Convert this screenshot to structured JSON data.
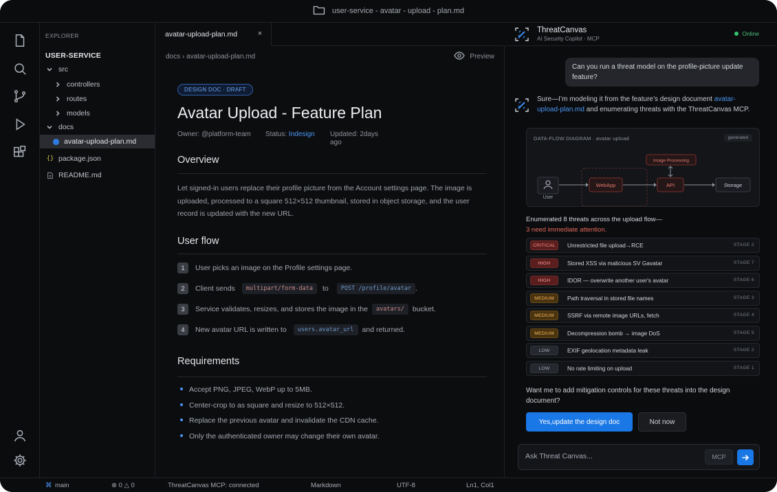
{
  "window": {
    "title": "user-service - avatar - upload - plan.md"
  },
  "activity_bar": {
    "icons": [
      "files-icon",
      "search-icon",
      "source-control-icon",
      "run-icon",
      "extensions-icon",
      "account-icon",
      "settings-gear-icon"
    ]
  },
  "explorer": {
    "title": "EXPLORER",
    "root": "USER-SERVICE",
    "items": [
      {
        "label": "src",
        "type": "folder-open"
      },
      {
        "label": "controllers",
        "type": "folder"
      },
      {
        "label": "routes",
        "type": "folder"
      },
      {
        "label": "models",
        "type": "folder"
      },
      {
        "label": "docs",
        "type": "folder-open"
      },
      {
        "label": "avatar-upload-plan.md",
        "type": "file-md",
        "active": true
      },
      {
        "label": "package.json",
        "type": "file-json"
      },
      {
        "label": "README.md",
        "type": "file-text"
      }
    ]
  },
  "editor": {
    "tab": {
      "label": "avatar-upload-plan.md",
      "close": "×"
    },
    "breadcrumb": "docs › avatar-upload-plan.md",
    "preview_label": "Preview",
    "badge": "DESIGN DOC · DRAFT",
    "title": "Avatar Upload - Feature Plan",
    "meta": {
      "owner": "Owner: @platform-team",
      "status_label": "Status:",
      "status_value": "Indesign",
      "updated_line1": "Updated: 2days",
      "updated_line2": "ago"
    },
    "overview": {
      "heading": "Overview",
      "text": "Let signed-in users replace their profile picture from the Account settings page. The image is uploaded, processed to a square 512×512 thumbnail, stored in object storage, and the user record is updated with the new URL."
    },
    "user_flow": {
      "heading": "User flow",
      "steps": [
        {
          "num": "1",
          "text": "User picks an image on the Profile settings page."
        },
        {
          "num": "2",
          "before": "Client sends",
          "code1": "multipart/form-data",
          "middle": "to",
          "code2": "POST /profile/avatar",
          "after": "."
        },
        {
          "num": "3",
          "before": "Service validates, resizes, and stores the image in the",
          "code1": "avatars/",
          "after": "bucket."
        },
        {
          "num": "4",
          "before": "New avatar URL is written to",
          "code1": "users.avatar_url",
          "after": "and returned."
        }
      ]
    },
    "requirements": {
      "heading": "Requirements",
      "items": [
        "Accept PNG, JPEG, WebP up to 5MB.",
        "Center-crop to as square and resize to 512×512.",
        "Replace the previous avatar and invalidate the CDN cache.",
        "Only the authenticated owner may change their own avatar."
      ]
    }
  },
  "copilot": {
    "name": "ThreatCanvas",
    "subtitle": "AI Security Copilot · MCP",
    "status": "Online",
    "user_message": "Can you run a threat model on the profile-picture update feature?",
    "ai_intro_1": "Sure—I’m modeling it from the feature’s design document",
    "ai_link": "avatar-upload-plan.md",
    "ai_intro_2": "and enumerating threats with the ThreatCanvas MCP.",
    "diagram": {
      "title": "DATA-FLOW DIAGRAM · avatar upload",
      "tag": "generated",
      "nodes": {
        "user": "User",
        "webapp": "WebApp",
        "api": "API",
        "storage": "Storage",
        "processing": "Image Processing"
      }
    },
    "summary_1": "Enumerated 8 threats across the upload flow—",
    "summary_2": "3 need immediate attention.",
    "threats": [
      {
        "severity": "CRITICAL",
        "level": "critical",
        "title": "Unrestricted file upload→RCE",
        "stage": "STAGE 2"
      },
      {
        "severity": "HIGH",
        "level": "high",
        "title": "Stored XSS via malicious SV Gavatar",
        "stage": "STAGE 7"
      },
      {
        "severity": "HIGH",
        "level": "high",
        "title": "IDOR — overwrite another user's avatar",
        "stage": "STAGE 6"
      },
      {
        "severity": "MEDIUM",
        "level": "medium",
        "title": "Path traversal in stored file names",
        "stage": "STAGE 3"
      },
      {
        "severity": "MEDIUM",
        "level": "medium",
        "title": "SSRF via remote image URLs, fetch",
        "stage": "STAGE 4"
      },
      {
        "severity": "MEDIUM",
        "level": "medium",
        "title": "Decompression bomb → image DoS",
        "stage": "STAGE 5"
      },
      {
        "severity": "LOW",
        "level": "low",
        "title": "EXIF geolocation metadata leak",
        "stage": "STAGE 2"
      },
      {
        "severity": "LOW",
        "level": "low",
        "title": "No rate limiting on upload",
        "stage": "STAGE 1"
      }
    ],
    "question": "Want me to add mitigation controls for these threats into the design document?",
    "primary_button": "Yes,update the design doc",
    "secondary_button": "Not now",
    "composer": {
      "placeholder": "Ask Threat Canvas...",
      "chip": "MCP"
    }
  },
  "status_bar": {
    "branch": "main",
    "problems": "⊕ 0 △ 0",
    "mcp": "ThreatCanvas MCP: connected",
    "language": "Markdown",
    "encoding": "UTF-8",
    "position": "Ln1, Col1"
  },
  "colors": {
    "accent": "#1a78e6",
    "online": "#35c46e",
    "critical": "#ff8f85",
    "medium": "#f2b55a"
  }
}
